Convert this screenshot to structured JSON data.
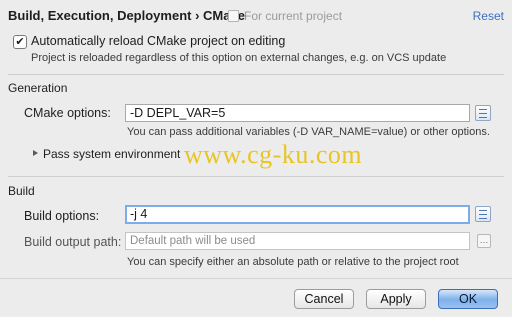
{
  "header": {
    "breadcrumb": "Build, Execution, Deployment › CMake",
    "scope_label": "For current project",
    "reset_label": "Reset"
  },
  "auto_reload": {
    "label": "Automatically reload CMake project on editing",
    "checked": true,
    "hint": "Project is reloaded regardless of this option on external changes, e.g. on VCS update"
  },
  "generation": {
    "section_title": "Generation",
    "cmake_options_label": "CMake options:",
    "cmake_options_value": "-D DEPL_VAR=5",
    "cmake_options_hint": "You can pass additional variables (-D VAR_NAME=value) or other options.",
    "pass_env_label": "Pass system environment"
  },
  "build": {
    "section_title": "Build",
    "build_options_label": "Build options:",
    "build_options_value": "-j 4",
    "output_path_label": "Build output path:",
    "output_path_placeholder": "Default path will be used",
    "output_path_hint": "You can specify either an absolute path or relative to the project root"
  },
  "watermark": "www.cg-ku.com",
  "footer": {
    "cancel_label": "Cancel",
    "apply_label": "Apply",
    "ok_label": "OK"
  },
  "colors": {
    "background": "#ececec",
    "link": "#3a6fc4",
    "focus_ring": "#7aaeeb",
    "default_button": "#7eb0eb",
    "watermark": "#e8c10d"
  },
  "icons": [
    "scope-file-icon",
    "expand-list-icon",
    "disclosure-triangle-icon",
    "browse-ellipsis-icon"
  ]
}
